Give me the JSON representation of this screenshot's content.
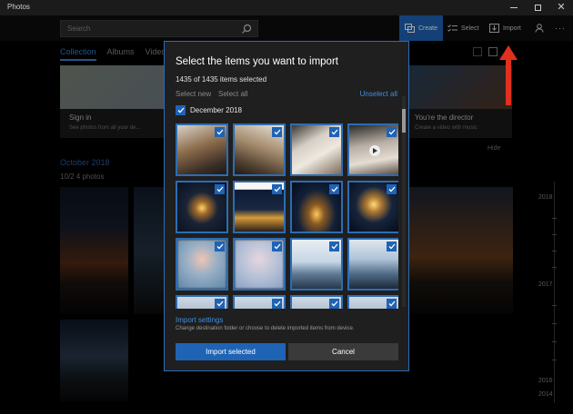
{
  "app": {
    "title": "Photos"
  },
  "commandbar": {
    "search_placeholder": "Search",
    "create_label": "Create",
    "select_label": "Select",
    "import_label": "Import"
  },
  "background": {
    "tabs": [
      "Collection",
      "Albums",
      "Video"
    ],
    "active_tab": "Collection",
    "sign_in_card": {
      "title": "Sign in",
      "subtitle": "See photos from all your de..."
    },
    "director_card": {
      "title": "You're the director",
      "subtitle": "Create a video with music"
    },
    "hide_label": "Hide",
    "month_label": "October 2018",
    "day_label": "10/2   4 photos",
    "timeline_years": [
      "2018",
      "2017",
      "2016",
      "2014"
    ]
  },
  "dialog": {
    "title": "Select the items you want to import",
    "selected_count": "1435 of 1435 items selected",
    "select_new": "Select new",
    "select_all": "Select all",
    "unselect_all": "Unselect all",
    "group_label": "December 2018",
    "import_settings_link": "Import settings",
    "import_settings_desc": "Change destination folder or choose to delete imported items from device.",
    "import_button": "Import selected",
    "cancel_button": "Cancel",
    "thumbnails": [
      {
        "name": "photo-cat-1",
        "style": "im-cat1",
        "video": false
      },
      {
        "name": "photo-cat-2",
        "style": "im-cat2",
        "video": false
      },
      {
        "name": "photo-hand",
        "style": "im-hand",
        "video": false
      },
      {
        "name": "video-clip",
        "style": "im-vid",
        "video": true
      },
      {
        "name": "photo-night-1",
        "style": "im-night1",
        "video": false
      },
      {
        "name": "photo-night-2",
        "style": "im-night2",
        "video": false
      },
      {
        "name": "photo-night-3",
        "style": "im-night3",
        "video": false
      },
      {
        "name": "photo-night-4",
        "style": "im-night4",
        "video": false
      },
      {
        "name": "photo-blurred-1",
        "style": "im-blur1",
        "video": false
      },
      {
        "name": "photo-blurred-2",
        "style": "im-blur2",
        "video": false
      },
      {
        "name": "photo-tower-1",
        "style": "im-tower1",
        "video": false
      },
      {
        "name": "photo-tower-2",
        "style": "im-tower2",
        "video": false
      },
      {
        "name": "photo-row4-1",
        "style": "im-row4",
        "video": false
      },
      {
        "name": "photo-row4-2",
        "style": "im-row4",
        "video": false
      },
      {
        "name": "photo-row4-3",
        "style": "im-row4",
        "video": false
      },
      {
        "name": "photo-row4-4",
        "style": "im-row4",
        "video": false
      }
    ]
  },
  "colors": {
    "accent": "#1f63b5",
    "link": "#3c8fe6",
    "dialog_bg": "#1f1f1f",
    "arrow": "#e0301e"
  }
}
